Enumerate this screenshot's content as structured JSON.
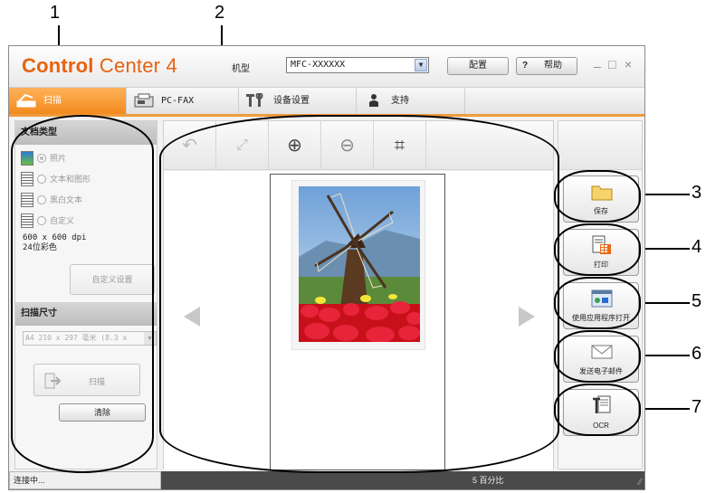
{
  "callouts": [
    "1",
    "2",
    "3",
    "4",
    "5",
    "6",
    "7"
  ],
  "app": {
    "logo_bold": "Control",
    "logo_thin": "Center 4",
    "model_label": "机型",
    "model_value": "MFC-XXXXXX",
    "config_label": "配置",
    "help_label": "帮助",
    "help_q": "?",
    "window_controls": [
      "_",
      "□",
      "×"
    ]
  },
  "tabs": [
    {
      "label": "扫描",
      "icon": "scan-icon",
      "active": true
    },
    {
      "label": "PC-FAX",
      "icon": "fax-icon",
      "active": false
    },
    {
      "label": "设备设置",
      "icon": "tools-icon",
      "active": false
    },
    {
      "label": "支持",
      "icon": "support-person-icon",
      "active": false
    }
  ],
  "left": {
    "doc_type_header": "文档类型",
    "options": [
      {
        "label": "照片",
        "selected": true
      },
      {
        "label": "文本和图形",
        "selected": false
      },
      {
        "label": "黑白文本",
        "selected": false
      },
      {
        "label": "自定义",
        "selected": false
      }
    ],
    "resolution": "600 x 600 dpi",
    "color_mode": "24位彩色",
    "custom_settings_label": "自定义设置",
    "scan_size_header": "扫描尺寸",
    "scan_size_value": "A4 210 x 297 毫米 (8.3 x",
    "scan_button_label": "扫描",
    "clear_button_label": "清除"
  },
  "toolbar": {
    "tools": [
      "rotate-icon",
      "fit-icon",
      "zoom-in-icon",
      "zoom-out-icon",
      "crop-icon"
    ]
  },
  "actions": [
    {
      "label": "保存",
      "icon": "folder-icon"
    },
    {
      "label": "打印",
      "icon": "print-icon"
    },
    {
      "label": "使用应用程序打开",
      "icon": "open-app-icon"
    },
    {
      "label": "发送电子邮件",
      "icon": "email-icon"
    },
    {
      "label": "OCR",
      "icon": "ocr-icon"
    }
  ],
  "status": {
    "left_text": "连接中...",
    "zoom_text": "5 百分比"
  },
  "colors": {
    "accent_orange": "#f28a1d",
    "logo_orange": "#e8620d"
  }
}
